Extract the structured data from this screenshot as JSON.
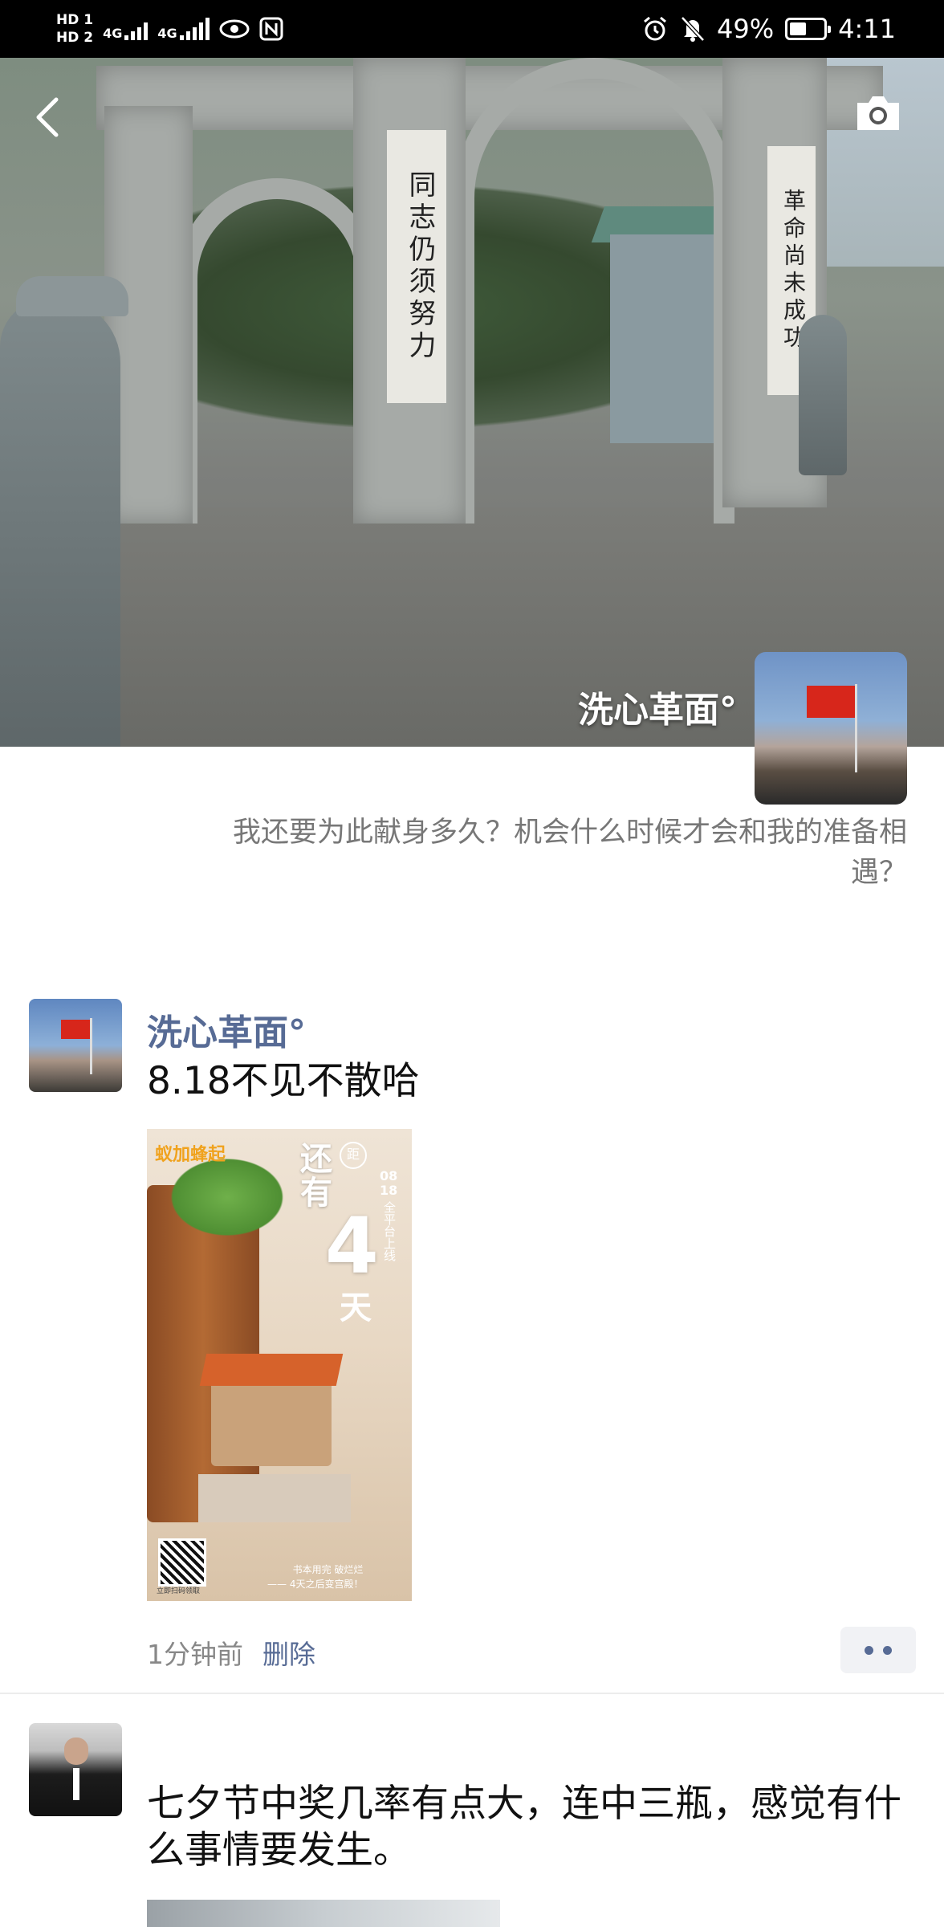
{
  "status_bar": {
    "hd1": "HD 1",
    "hd2": "HD 2",
    "net1": "4G",
    "net2": "4G",
    "battery_percent": "49%",
    "battery_level": 0.49,
    "time": "4:11"
  },
  "cover": {
    "banner_left": "同志仍须努力",
    "banner_right": "革命尚未成功",
    "owner_name": "洗心革面°",
    "signature": "我还要为此献身多久？机会什么时候才会和我的准备相遇？"
  },
  "posts": [
    {
      "nick": "洗心革面°",
      "text": "8.18不见不散哈",
      "poster": {
        "logo": "蚁加蜂起",
        "countdown_label": "还有",
        "countdown_number": "4",
        "countdown_unit": "天",
        "badge": "距",
        "date": "08\n18",
        "platform": "全平台上线",
        "caption": "书本用完 破烂烂\n—— 4天之后变宫殿！",
        "qr_caption": "立即扫码领取"
      },
      "time": "1分钟前",
      "delete_label": "删除"
    },
    {
      "nick": "",
      "text": "七夕节中奖几率有点大，连中三瓶，感觉有什么事情要发生。"
    }
  ],
  "colors": {
    "nickname": "#576b95",
    "status_bar_bg": "#000000",
    "meta_text": "#888888"
  },
  "icons": [
    "back-arrow-icon",
    "camera-icon",
    "alarm-icon",
    "mute-bell-icon",
    "eye-icon",
    "nfc-icon",
    "more-dots-icon"
  ]
}
